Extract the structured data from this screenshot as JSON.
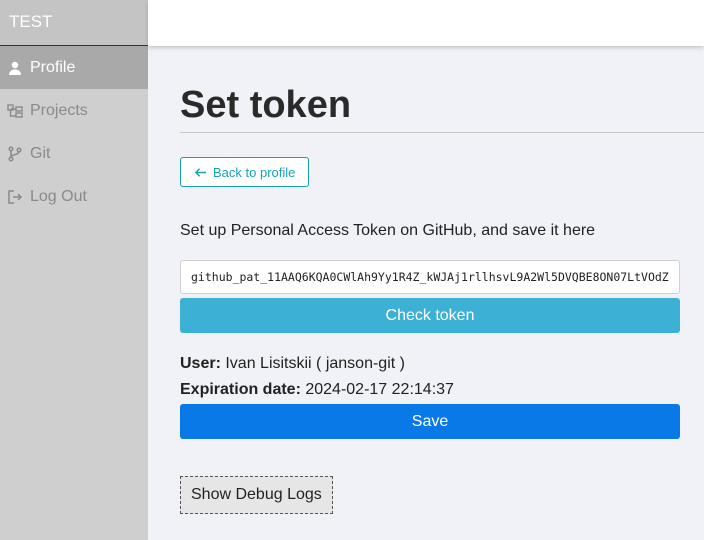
{
  "sidebar": {
    "brand": "TEST",
    "items": [
      {
        "label": "Profile",
        "icon": "user-icon",
        "active": true
      },
      {
        "label": "Projects",
        "icon": "projects-icon",
        "active": false
      },
      {
        "label": "Git",
        "icon": "git-branch-icon",
        "active": false
      },
      {
        "label": "Log Out",
        "icon": "logout-icon",
        "active": false
      }
    ]
  },
  "main": {
    "title": "Set token",
    "back_label": "Back to profile",
    "description": "Set up Personal Access Token on GitHub, and save it here",
    "token_value": "github_pat_11AAQ6KQA0CWlAh9Yy1R4Z_kWJAj1rllhsvL9A2Wl5DVQBE8ON07LtVOdZ",
    "check_label": "Check token",
    "user_label": "User:",
    "user_value": "Ivan Lisitskii ( janson-git )",
    "expiration_label": "Expiration date:",
    "expiration_value": "2024-02-17 22:14:37",
    "save_label": "Save",
    "debug_label": "Show Debug Logs"
  },
  "colors": {
    "accent_info": "#17a2b8",
    "check_button": "#3db0d6",
    "save_button": "#0a79e8"
  }
}
